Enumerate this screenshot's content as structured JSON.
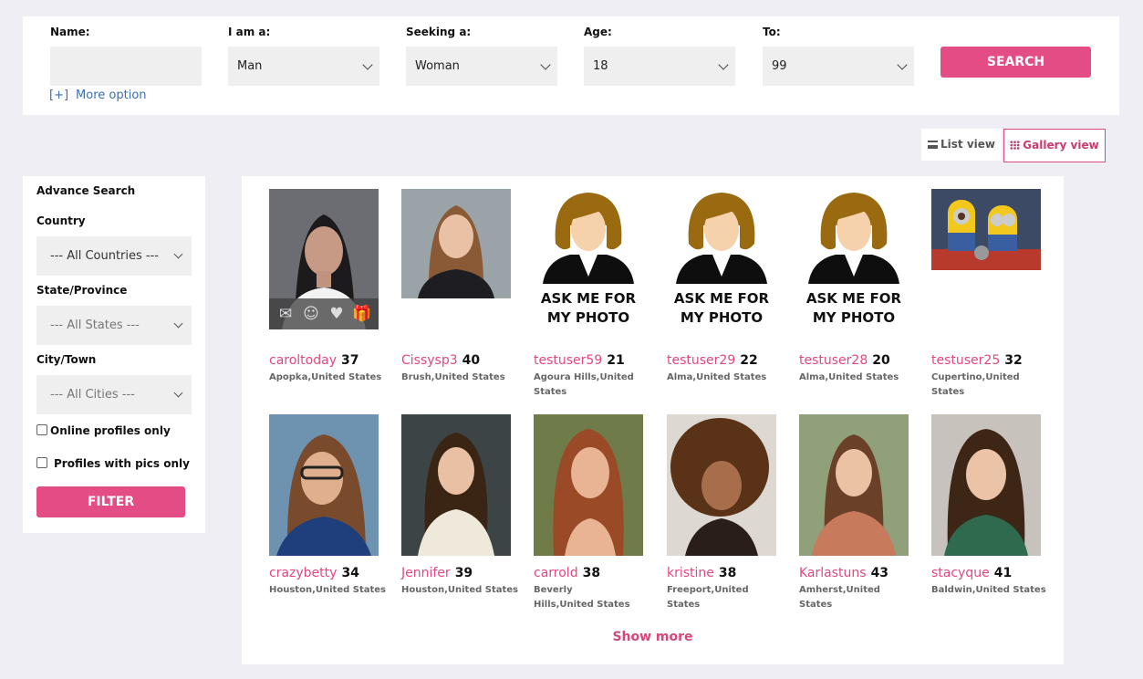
{
  "search": {
    "name_label": "Name:",
    "name_value": "",
    "iam_label": "I am a:",
    "iam_value": "Man",
    "seeking_label": "Seeking a:",
    "seeking_value": "Woman",
    "age_label": "Age:",
    "age_value": "18",
    "to_label": "To:",
    "to_value": "99",
    "search_button": "SEARCH",
    "more_bracket": "[+]",
    "more_option": "More option"
  },
  "views": {
    "list_view": "List view",
    "gallery_view": "Gallery view"
  },
  "sidebar": {
    "title": "Advance Search",
    "country_label": "Country",
    "country_value": "--- All Countries ---",
    "state_label": "State/Province",
    "state_value": "--- All States ---",
    "city_label": "City/Town",
    "city_value": "--- All Cities ---",
    "online_only": "Online profiles only",
    "pics_only": "Profiles with pics only",
    "filter_button": "FILTER"
  },
  "profiles": [
    {
      "username": "caroltoday",
      "age": "37",
      "location": "Apopka,United States"
    },
    {
      "username": "Cissysp3",
      "age": "40",
      "location": "Brush,United States"
    },
    {
      "username": "testuser59",
      "age": "21",
      "location": "Agoura Hills,United States"
    },
    {
      "username": "testuser29",
      "age": "22",
      "location": "Alma,United States"
    },
    {
      "username": "testuser28",
      "age": "20",
      "location": "Alma,United States"
    },
    {
      "username": "testuser25",
      "age": "32",
      "location": "Cupertino,United States"
    },
    {
      "username": "crazybetty",
      "age": "34",
      "location": "Houston,United States"
    },
    {
      "username": "Jennifer",
      "age": "39",
      "location": "Houston,United States"
    },
    {
      "username": "carrold",
      "age": "38",
      "location": "Beverly Hills,United States"
    },
    {
      "username": "kristine",
      "age": "38",
      "location": "Freeport,United States"
    },
    {
      "username": "Karlastuns",
      "age": "43",
      "location": "Amherst,United States"
    },
    {
      "username": "stacyque",
      "age": "41",
      "location": "Baldwin,United States"
    }
  ],
  "placeholder_text": "ASK ME FOR MY PHOTO",
  "show_more": "Show more",
  "colors": {
    "accent": "#e44c86",
    "link": "#3a6fae",
    "background": "#eeeef4"
  }
}
